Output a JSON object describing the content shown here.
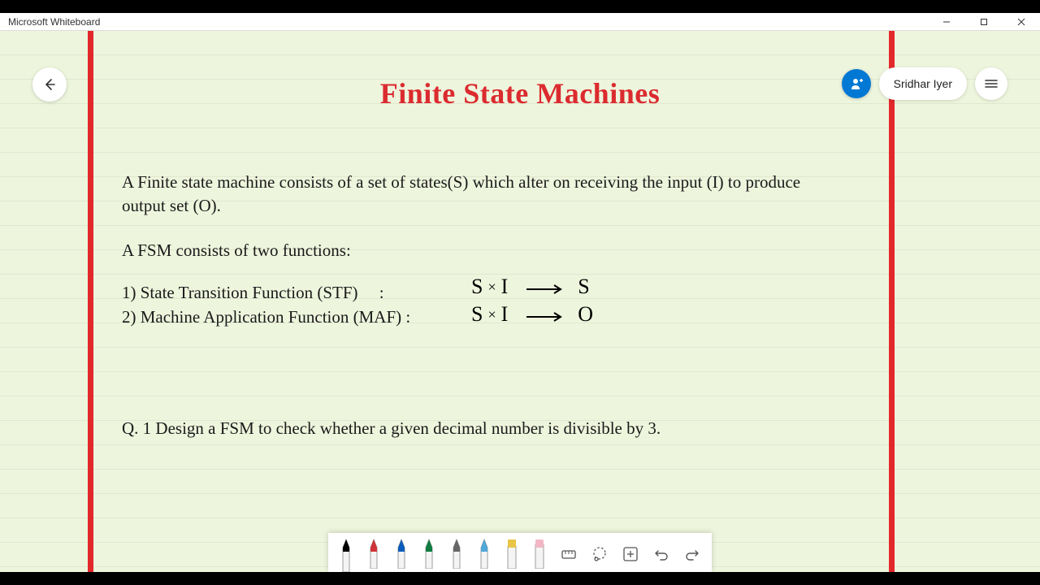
{
  "app": {
    "title": "Microsoft Whiteboard"
  },
  "user": {
    "name": "Sridhar Iyer"
  },
  "content": {
    "heading": "Finite State Machines",
    "para1": "A Finite state machine consists of a set of states(S) which alter on receiving the input (I) to produce output set (O).",
    "para2": "A FSM consists of two functions:",
    "func1": "1) State Transition Function (STF)     :",
    "func2": "2) Machine Application Function (MAF) :",
    "formula1_lhs_a": "S",
    "formula1_lhs_b": "I",
    "formula1_rhs": "S",
    "formula2_lhs_a": "S",
    "formula2_lhs_b": "I",
    "formula2_rhs": "O",
    "question": "Q. 1 Design a FSM to check whether a given decimal number is divisible by 3."
  },
  "toolbar": {
    "pens": [
      {
        "color": "#000000"
      },
      {
        "color": "#d13438"
      },
      {
        "color": "#0c5db9"
      },
      {
        "color": "#107c41"
      },
      {
        "color": "#555555"
      },
      {
        "color": "#4fa8d8"
      },
      {
        "color": "#e8c547",
        "type": "highlighter"
      },
      {
        "color": "#f2b6c4",
        "type": "eraser"
      }
    ]
  }
}
